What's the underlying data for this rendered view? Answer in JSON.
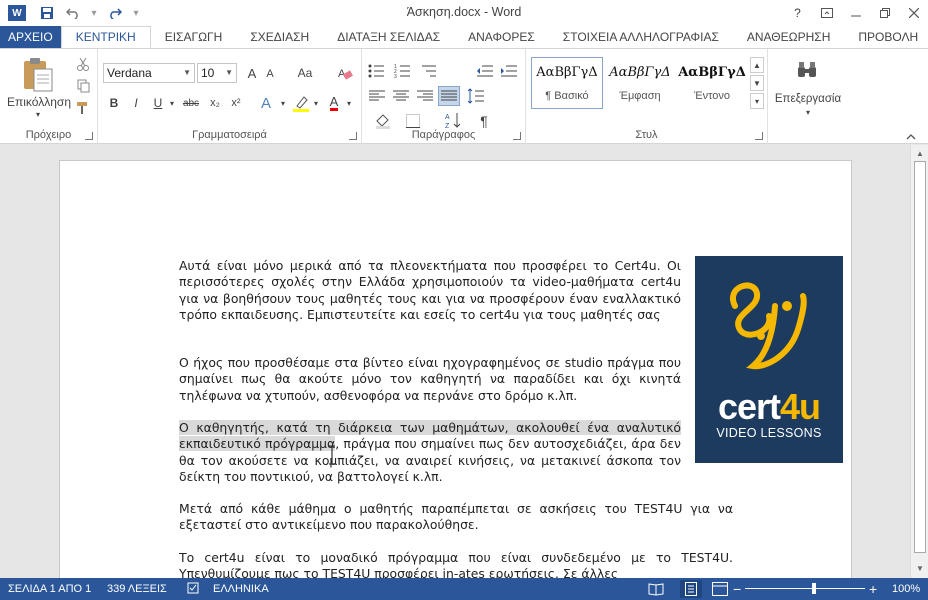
{
  "title_bar": {
    "app_icon": "word-icon",
    "app_icon_letter": "W",
    "document_title": "Άσκηση.docx - Word",
    "window_buttons": [
      "help",
      "ribbon-display-options",
      "minimize",
      "restore",
      "close"
    ],
    "help_label": "?"
  },
  "tabs": [
    {
      "label": "ΑΡΧΕΙΟ"
    },
    {
      "label": "ΚΕΝΤΡΙΚΗ"
    },
    {
      "label": "ΕΙΣΑΓΩΓΗ"
    },
    {
      "label": "ΣΧΕΔΙΑΣΗ"
    },
    {
      "label": "ΔΙΑΤΑΞΗ ΣΕΛΙΔΑΣ"
    },
    {
      "label": "ΑΝΑΦΟΡΕΣ"
    },
    {
      "label": "ΣΤΟΙΧΕΙΑ ΑΛΛΗΛΟΓΡΑΦΙΑΣ"
    },
    {
      "label": "ΑΝΑΘΕΩΡΗΣΗ"
    },
    {
      "label": "ΠΡΟΒΟΛΗ"
    }
  ],
  "ribbon": {
    "clipboard": {
      "label": "Πρόχειρο",
      "paste_label": "Επικόλληση"
    },
    "font": {
      "label": "Γραμματοσειρά",
      "font_name": "Verdana",
      "font_size": "10",
      "bold": "B",
      "italic": "I",
      "underline": "U",
      "strike": "abc",
      "subscript": "x₂",
      "superscript": "x²",
      "grow": "A",
      "shrink": "A",
      "change_case": "Aa",
      "font_color": "A",
      "highlight": "ab",
      "effects": "A"
    },
    "paragraph": {
      "label": "Παράγραφος",
      "pilcrow": "¶"
    },
    "styles": {
      "label": "Στυλ",
      "items": [
        {
          "sample": "ΑαΒβΓγΔ",
          "name": "¶ Βασικό"
        },
        {
          "sample": "ΑαΒβΓγΔ",
          "name": "Έμφαση"
        },
        {
          "sample": "ΑαΒβΓγΔ",
          "name": "Έντονο"
        }
      ]
    },
    "editing": {
      "label": "Επεξεργασία"
    }
  },
  "document": {
    "paragraphs": [
      {
        "text": "Αυτά είναι μόνο μερικά από τα πλεονεκτήματα που προσφέρει το Cert4u. Οι περισσότερες σχολές στην Ελλάδα χρησιμοποιούν τα video-μαθήματα cert4u για να βοηθήσουν τους μαθητές τους και για να προσφέρουν έναν εναλλακτικό τρόπο εκπαιδευσης. Εμπιστευτείτε και εσείς το cert4u για τους μαθητές σας"
      },
      {
        "text": "Ο ήχος που προσθέσαμε στα βίντεο είναι ηχογραφημένος σε studio πράγμα που σημαίνει πως θα ακούτε μόνο τον καθηγητή να παραδίδει  και όχι κινητά τηλέφωνα να χτυπούν, ασθενοφόρα να περνάνε στο δρόμο κ.λπ."
      },
      {
        "highlighted": "Ο καθηγητής, κατά τη διάρκεια των μαθημάτων, ακολουθεί ένα αναλυτικό εκπαιδευτικό πρόγραμμα",
        "text": ", πράγμα που σημαίνει πως δεν αυτοσχεδιάζει, άρα δεν θα τον ακούσετε να κομπιάζει, να αναιρεί κινήσεις, να μετακινεί  άσκοπα τον δείκτη του ποντικιού, να βαττολογεί  κ.λπ."
      },
      {
        "text": "Μετά από κάθε μάθημα ο μαθητής παραπέμπεται  σε ασκήσεις του TEST4U για να εξεταστεί στο αντικείμενο που παρακολούθησε."
      },
      {
        "text": "Το cert4u είναι το μοναδικό πρόγραμμα που είναι συνδεδεμένο με το TEST4U. Υπενθυμίζουμε πως το TEST4U προσφέρει in-ates ερωτήσεις. Σε άλλες"
      }
    ],
    "logo": {
      "brand_main": "cert",
      "brand_accent": "4u",
      "tagline": "VIDEO LESSONS",
      "bg_color": "#1d3a5f",
      "accent_color": "#f5b800"
    }
  },
  "status_bar": {
    "page": "ΣΕΛΙΔΑ 1 ΑΠΟ 1",
    "words": "339 ΛΕΞΕΙΣ",
    "language": "ΕΛΛΗΝΙΚΑ",
    "zoom_minus": "−",
    "zoom_plus": "+",
    "zoom": "100%"
  },
  "colors": {
    "accent": "#2b579a"
  }
}
